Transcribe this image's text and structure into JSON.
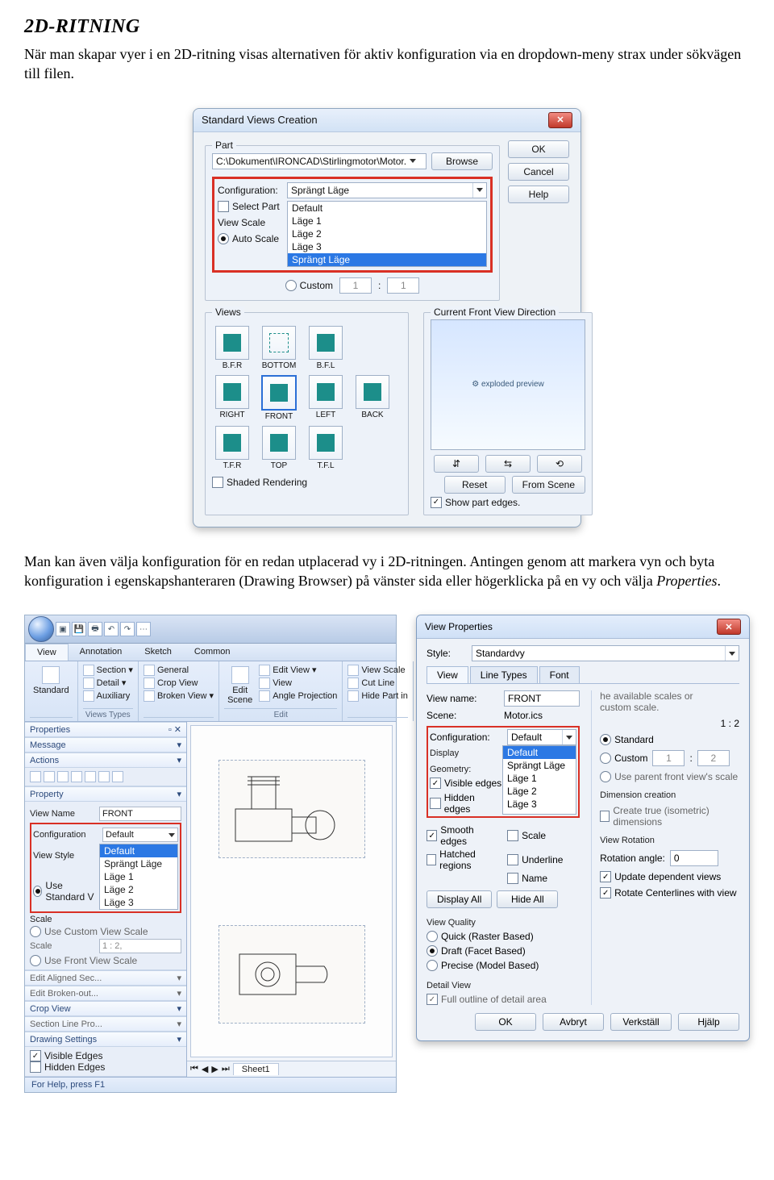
{
  "doc": {
    "heading": "2D-RITNING",
    "p1": "När man skapar vyer i en 2D-ritning visas alternativen för aktiv konfiguration via en dropdown-meny strax under sökvägen till filen.",
    "p2a": "Man kan även välja konfiguration för en redan utplacerad vy i 2D-ritningen. Antingen genom att markera vyn och byta konfiguration i egenskapshanteraren (Drawing Browser) på vänster sida eller högerklicka på en vy och välja ",
    "p2b": "Properties",
    "p2c": "."
  },
  "svc": {
    "title": "Standard Views Creation",
    "part_label": "Part",
    "path": "C:\\Dokument\\IRONCAD\\Stirlingmotor\\Motor.",
    "browse": "Browse",
    "ok": "OK",
    "cancel": "Cancel",
    "help": "Help",
    "config_label": "Configuration:",
    "config_value": "Sprängt Läge",
    "options": [
      "Default",
      "Läge 1",
      "Läge 2",
      "Läge 3",
      "Sprängt Läge"
    ],
    "select_part": "Select Part",
    "view_scale": "View Scale",
    "auto_scale": "Auto Scale",
    "custom": "Custom",
    "ratio_a": "1",
    "ratio_b": "1",
    "views_label": "Views",
    "cfvd_label": "Current Front View Direction",
    "views": [
      "B.F.R",
      "BOTTOM",
      "B.F.L",
      "",
      "RIGHT",
      "FRONT",
      "LEFT",
      "BACK",
      "T.F.R",
      "TOP",
      "T.F.L",
      ""
    ],
    "reset": "Reset",
    "from_scene": "From Scene",
    "show_part_edges": "Show part edges.",
    "shaded": "Shaded Rendering"
  },
  "app": {
    "tabs": [
      "View",
      "Annotation",
      "Sketch",
      "Common"
    ],
    "ribbon": {
      "standard": "Standard",
      "vt": {
        "section": "Section ▾",
        "detail": "Detail ▾",
        "aux": "Auxiliary",
        "general": "General",
        "crop": "Crop View",
        "broken": "Broken View ▾",
        "label": "Views Types"
      },
      "edit": {
        "scene": "Edit\nScene",
        "editview": "Edit View ▾",
        "view": "View",
        "angle": "Angle Projection",
        "label": "Edit"
      },
      "misc": {
        "scale": "View Scale",
        "cut": "Cut Line",
        "hide": "Hide Part in"
      }
    },
    "props": {
      "properties": "Properties",
      "message": "Message",
      "actions": "Actions",
      "property": "Property",
      "view_name_lbl": "View Name",
      "view_name": "FRONT",
      "config_lbl": "Configuration",
      "config_val": "Default",
      "config_opts": [
        "Default",
        "Sprängt Läge",
        "Läge 1",
        "Läge 2",
        "Läge 3"
      ],
      "view_style": "View Style",
      "use_std": "Use Standard V",
      "scale_lbl": "Scale",
      "use_custom": "Use Custom View Scale",
      "scale_val": "1 : 2,",
      "use_front": "Use Front View Scale",
      "edit_aligned": "Edit Aligned Sec...",
      "edit_broken": "Edit Broken-out...",
      "crop": "Crop View",
      "section_line": "Section Line Pro...",
      "drawing_settings": "Drawing Settings",
      "visible_edges": "Visible Edges",
      "hidden_edges": "Hidden Edges"
    },
    "sheet": "Sheet1",
    "status": "For Help, press F1"
  },
  "vp": {
    "title": "View Properties",
    "style_lbl": "Style:",
    "style_val": "Standardvy",
    "tabs": [
      "View",
      "Line Types",
      "Font"
    ],
    "view_name_lbl": "View name:",
    "view_name": "FRONT",
    "scene_lbl": "Scene:",
    "scene_val": "Motor.ics",
    "config_lbl": "Configuration:",
    "config_val": "Default",
    "config_opts": [
      "Default",
      "Sprängt Läge",
      "Läge 1",
      "Läge 2",
      "Läge 3"
    ],
    "display": "Display",
    "geometry": "Geometry:",
    "visible": "Visible edges",
    "hidden": "Hidden edges",
    "smooth": "Smooth edges",
    "hatched": "Hatched regions",
    "name_chk": "Name",
    "scale_chk": "Scale",
    "underline": "Underline",
    "display_all": "Display All",
    "hide_all": "Hide All",
    "quality": "View Quality",
    "quick": "Quick (Raster Based)",
    "draft": "Draft (Facet Based)",
    "precise": "Precise (Model Based)",
    "detail": "Detail View",
    "full_outline": "Full outline of detail area",
    "avail": "he available scales or\ncustom scale.",
    "cur_scale": "1 : 2",
    "standard": "Standard",
    "custom": "Custom",
    "ratio_a": "1",
    "ratio_b": "2",
    "use_parent": "Use parent front view's scale",
    "dim_cr": "Dimension creation",
    "create_iso": "Create true (isometric) dimensions",
    "view_rot": "View Rotation",
    "rot_lbl": "Rotation angle:",
    "rot_val": "0",
    "update": "Update dependent views",
    "rotate_center": "Rotate Centerlines with view",
    "ok": "OK",
    "avbryt": "Avbryt",
    "verkstall": "Verkställ",
    "hjalp": "Hjälp"
  }
}
